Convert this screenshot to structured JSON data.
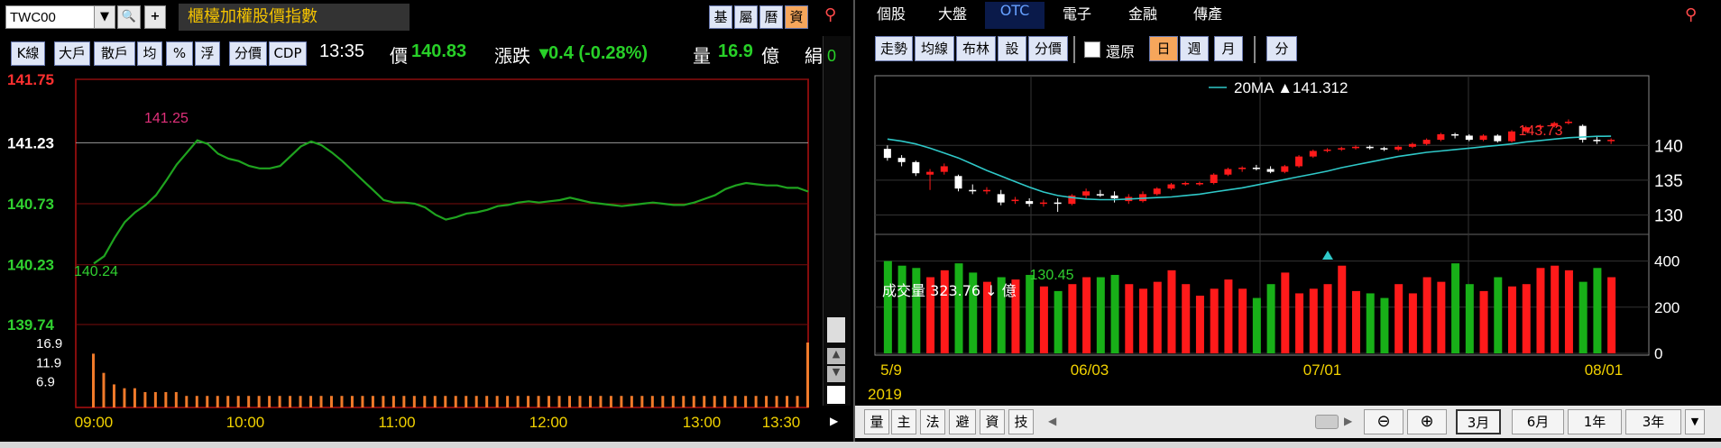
{
  "left": {
    "symbol": "TWC00",
    "title": "櫃檯加權股價指數",
    "side_buttons": [
      "基",
      "屬",
      "曆",
      "資"
    ],
    "chart_buttons": [
      "K線",
      "大戶",
      "散戶",
      "均",
      "%",
      "浮",
      "分價",
      "CDP"
    ],
    "time": "13:35",
    "price_label": "價",
    "price": "140.83",
    "change_label": "漲跌",
    "change": "▾0.4 (-0.28%)",
    "volume_label": "量",
    "volume": "16.9",
    "volume_unit": "億",
    "trail_text": "絹",
    "trail_text2": "0"
  },
  "right": {
    "tabs": [
      "個股",
      "大盤",
      "OTC",
      "電子",
      "金融",
      "傳產"
    ],
    "selected_tab": "OTC",
    "tool_buttons": [
      "走勢",
      "均線",
      "布林",
      "設",
      "分價"
    ],
    "restore_label": "還原",
    "period_buttons": [
      "日",
      "週",
      "月"
    ],
    "period_selected": "日",
    "fen_button": "分",
    "ma_legend": "20MA ▲141.312",
    "volume_text": "成交量 323.76 ↓ 億",
    "year_label": "2019",
    "bottom_tabs": [
      "量",
      "主",
      "法",
      "避",
      "資",
      "技"
    ],
    "range_buttons": [
      "3月",
      "6月",
      "1年",
      "3年"
    ],
    "range_selected": "3月"
  },
  "colors": {
    "up": "#ff1a1a",
    "down": "#18b018",
    "ma": "#2fc8c8",
    "accent": "#f6a65b"
  },
  "chart_data": [
    {
      "type": "line",
      "title": "",
      "y_ticks": [
        "141.75",
        "141.23",
        "140.73",
        "140.23",
        "139.74"
      ],
      "ylim": [
        139.74,
        141.75
      ],
      "x_ticks": [
        "09:00",
        "10:00",
        "11:00",
        "12:00",
        "13:00",
        "13:30"
      ],
      "volume_ticks": [
        "16.9",
        "11.9",
        "6.9"
      ],
      "high_label": "141.25",
      "low_label": "140.24",
      "series": [
        {
          "values": [
            140.24,
            140.3,
            140.45,
            140.58,
            140.66,
            140.72,
            140.8,
            140.92,
            141.05,
            141.15,
            141.25,
            141.22,
            141.14,
            141.1,
            141.08,
            141.04,
            141.02,
            141.02,
            141.04,
            141.12,
            141.2,
            141.24,
            141.21,
            141.15,
            141.08,
            141.0,
            140.92,
            140.84,
            140.76,
            140.74,
            140.74,
            140.73,
            140.7,
            140.64,
            140.6,
            140.62,
            140.65,
            140.66,
            140.68,
            140.71,
            140.72,
            140.74,
            140.75,
            140.74,
            140.75,
            140.76,
            140.78,
            140.76,
            140.74,
            140.73,
            140.72,
            140.71,
            140.72,
            140.73,
            140.74,
            140.73,
            140.72,
            140.72,
            140.74,
            140.77,
            140.8,
            140.85,
            140.88,
            140.9,
            140.89,
            140.88,
            140.88,
            140.86,
            140.86,
            140.83
          ]
        }
      ],
      "volume": [
        14,
        9,
        6,
        5,
        5,
        4,
        4,
        4,
        4,
        3,
        3,
        3,
        3,
        3,
        3,
        3,
        3,
        3,
        3,
        3,
        3,
        3,
        3,
        3,
        3,
        3,
        3,
        3,
        3,
        3,
        3,
        3,
        3,
        3,
        3,
        3,
        3,
        3,
        3,
        3,
        3,
        3,
        3,
        3,
        3,
        3,
        3,
        3,
        3,
        3,
        3,
        3,
        3,
        3,
        3,
        3,
        3,
        3,
        3,
        3,
        3,
        3,
        3,
        3,
        3,
        3,
        3,
        3,
        3,
        16.9
      ]
    },
    {
      "type": "candlestick",
      "title": "",
      "y_ticks": [
        "140",
        "135",
        "130"
      ],
      "ylim": [
        128,
        150
      ],
      "volume_ticks": [
        "400",
        "200",
        "0"
      ],
      "volume_lim": [
        0,
        500
      ],
      "x_ticks": [
        "5/9",
        "06/03",
        "07/01",
        "08/01"
      ],
      "annotations": [
        "143.73",
        "130.45"
      ],
      "ma": [
        140.9,
        140.6,
        140.2,
        139.6,
        138.9,
        138.2,
        137.3,
        136.4,
        135.6,
        134.8,
        134.0,
        133.3,
        132.8,
        132.5,
        132.3,
        132.2,
        132.2,
        132.3,
        132.4,
        132.5,
        132.6,
        132.8,
        133.0,
        133.3,
        133.6,
        133.9,
        134.3,
        134.7,
        135.1,
        135.5,
        135.9,
        136.3,
        136.8,
        137.2,
        137.6,
        138.0,
        138.4,
        138.7,
        139.0,
        139.2,
        139.4,
        139.6,
        139.8,
        140.0,
        140.2,
        140.5,
        140.7,
        140.9,
        141.1,
        141.2,
        141.3,
        141.31
      ],
      "candles": [
        {
          "o": 139.5,
          "c": 138.2,
          "h": 140.0,
          "l": 137.8
        },
        {
          "o": 138.2,
          "c": 137.6,
          "h": 138.6,
          "l": 137.0
        },
        {
          "o": 137.6,
          "c": 136.0,
          "h": 137.8,
          "l": 135.6
        },
        {
          "o": 135.8,
          "c": 136.2,
          "h": 136.6,
          "l": 133.6
        },
        {
          "o": 136.2,
          "c": 137.0,
          "h": 137.4,
          "l": 135.8
        },
        {
          "o": 135.6,
          "c": 133.8,
          "h": 135.8,
          "l": 133.4
        },
        {
          "o": 133.6,
          "c": 133.4,
          "h": 134.4,
          "l": 133.0
        },
        {
          "o": 133.4,
          "c": 133.6,
          "h": 134.0,
          "l": 133.0
        },
        {
          "o": 133.0,
          "c": 131.8,
          "h": 133.6,
          "l": 131.4
        },
        {
          "o": 132.0,
          "c": 132.2,
          "h": 132.6,
          "l": 131.6
        },
        {
          "o": 132.0,
          "c": 131.6,
          "h": 132.4,
          "l": 131.2
        },
        {
          "o": 131.6,
          "c": 131.8,
          "h": 132.2,
          "l": 131.2
        },
        {
          "o": 131.8,
          "c": 131.6,
          "h": 132.4,
          "l": 130.45
        },
        {
          "o": 131.6,
          "c": 132.8,
          "h": 133.0,
          "l": 131.4
        },
        {
          "o": 132.8,
          "c": 133.4,
          "h": 133.8,
          "l": 132.4
        },
        {
          "o": 133.0,
          "c": 132.8,
          "h": 133.6,
          "l": 132.6
        },
        {
          "o": 132.8,
          "c": 132.4,
          "h": 133.4,
          "l": 131.8
        },
        {
          "o": 132.0,
          "c": 132.6,
          "h": 133.0,
          "l": 131.6
        },
        {
          "o": 132.0,
          "c": 133.0,
          "h": 133.4,
          "l": 131.8
        },
        {
          "o": 133.0,
          "c": 133.8,
          "h": 134.0,
          "l": 132.8
        },
        {
          "o": 133.8,
          "c": 134.4,
          "h": 134.6,
          "l": 133.6
        },
        {
          "o": 134.4,
          "c": 134.6,
          "h": 134.8,
          "l": 134.2
        },
        {
          "o": 134.4,
          "c": 134.6,
          "h": 134.8,
          "l": 134.2
        },
        {
          "o": 134.6,
          "c": 135.8,
          "h": 136.0,
          "l": 134.4
        },
        {
          "o": 135.8,
          "c": 136.6,
          "h": 136.8,
          "l": 135.6
        },
        {
          "o": 136.6,
          "c": 136.8,
          "h": 137.0,
          "l": 136.2
        },
        {
          "o": 136.8,
          "c": 136.6,
          "h": 137.2,
          "l": 136.4
        },
        {
          "o": 136.6,
          "c": 136.2,
          "h": 137.0,
          "l": 136.0
        },
        {
          "o": 136.2,
          "c": 137.0,
          "h": 137.2,
          "l": 136.0
        },
        {
          "o": 137.0,
          "c": 138.4,
          "h": 138.6,
          "l": 136.8
        },
        {
          "o": 138.4,
          "c": 139.2,
          "h": 139.4,
          "l": 138.2
        },
        {
          "o": 139.2,
          "c": 139.4,
          "h": 139.6,
          "l": 139.0
        },
        {
          "o": 139.4,
          "c": 139.6,
          "h": 139.8,
          "l": 139.2
        },
        {
          "o": 139.6,
          "c": 139.8,
          "h": 140.0,
          "l": 139.4
        },
        {
          "o": 139.8,
          "c": 139.6,
          "h": 140.0,
          "l": 139.4
        },
        {
          "o": 139.6,
          "c": 139.4,
          "h": 139.8,
          "l": 139.2
        },
        {
          "o": 139.4,
          "c": 139.8,
          "h": 140.0,
          "l": 139.2
        },
        {
          "o": 139.8,
          "c": 140.2,
          "h": 140.4,
          "l": 139.6
        },
        {
          "o": 140.2,
          "c": 140.8,
          "h": 141.0,
          "l": 140.0
        },
        {
          "o": 140.8,
          "c": 141.6,
          "h": 141.8,
          "l": 140.6
        },
        {
          "o": 141.6,
          "c": 141.4,
          "h": 141.8,
          "l": 141.0
        },
        {
          "o": 141.4,
          "c": 140.8,
          "h": 141.6,
          "l": 140.6
        },
        {
          "o": 140.8,
          "c": 141.4,
          "h": 141.6,
          "l": 140.6
        },
        {
          "o": 141.4,
          "c": 140.6,
          "h": 141.6,
          "l": 140.4
        },
        {
          "o": 140.6,
          "c": 142.0,
          "h": 142.2,
          "l": 140.4
        },
        {
          "o": 142.0,
          "c": 142.6,
          "h": 142.8,
          "l": 141.8
        },
        {
          "o": 142.6,
          "c": 142.8,
          "h": 143.0,
          "l": 142.4
        },
        {
          "o": 142.8,
          "c": 143.2,
          "h": 143.4,
          "l": 142.6
        },
        {
          "o": 143.2,
          "c": 143.4,
          "h": 143.73,
          "l": 143.0
        },
        {
          "o": 142.8,
          "c": 140.8,
          "h": 143.0,
          "l": 140.4
        },
        {
          "o": 140.8,
          "c": 140.6,
          "h": 141.2,
          "l": 140.2
        },
        {
          "o": 140.6,
          "c": 140.8,
          "h": 141.0,
          "l": 140.2
        }
      ],
      "volume": [
        400,
        380,
        370,
        330,
        360,
        390,
        350,
        310,
        330,
        320,
        340,
        290,
        270,
        300,
        330,
        330,
        340,
        300,
        280,
        310,
        360,
        300,
        250,
        280,
        320,
        280,
        240,
        300,
        350,
        260,
        280,
        300,
        380,
        270,
        260,
        240,
        300,
        260,
        330,
        310,
        390,
        300,
        270,
        330,
        290,
        300,
        370,
        380,
        360,
        310,
        370,
        330
      ]
    }
  ]
}
